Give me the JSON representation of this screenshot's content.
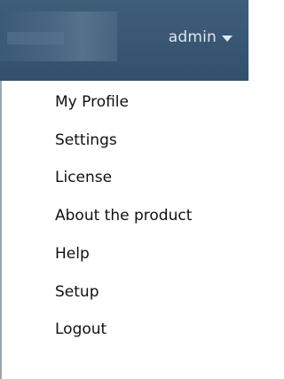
{
  "header": {
    "username": "admin",
    "caret_icon": "caret-down-icon",
    "background_color": "#3a5774"
  },
  "user_menu": {
    "items": [
      {
        "label": "My Profile"
      },
      {
        "label": "Settings"
      },
      {
        "label": "License"
      },
      {
        "label": "About the product"
      },
      {
        "label": "Help"
      },
      {
        "label": "Setup"
      },
      {
        "label": "Logout"
      }
    ]
  }
}
